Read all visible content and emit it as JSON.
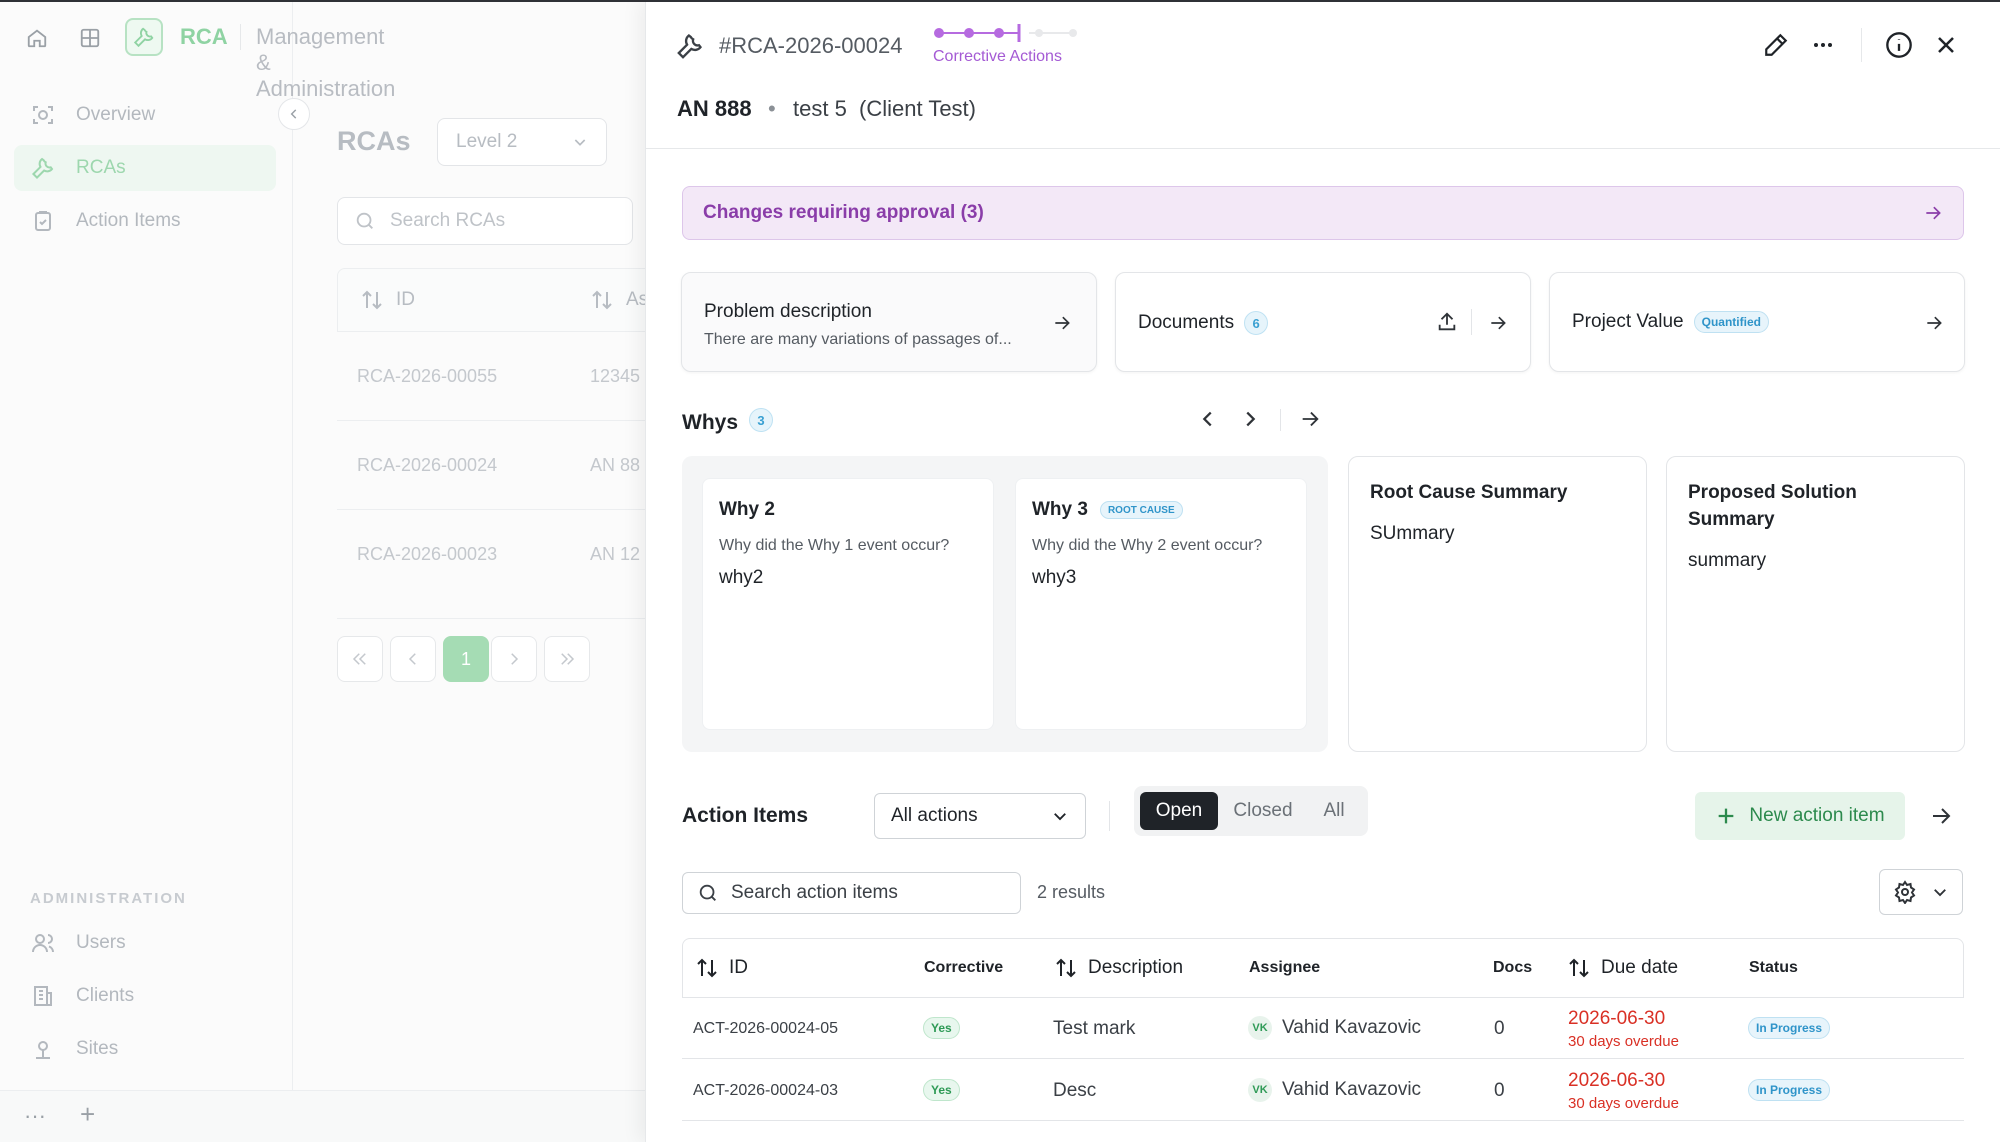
{
  "topbar": {
    "brand": "RCA",
    "section": "Management & Administration"
  },
  "sidebar": {
    "items": [
      {
        "label": "Overview",
        "icon": "overview-icon"
      },
      {
        "label": "RCAs",
        "icon": "wrench-icon"
      },
      {
        "label": "Action Items",
        "icon": "clipboard-icon"
      }
    ],
    "admin_label": "ADMINISTRATION",
    "admin_items": [
      {
        "label": "Users",
        "icon": "users-icon"
      },
      {
        "label": "Clients",
        "icon": "building-icon"
      },
      {
        "label": "Sites",
        "icon": "location-icon"
      }
    ]
  },
  "list": {
    "title": "RCAs",
    "level": "Level 2",
    "search_placeholder": "Search RCAs",
    "col_id": "ID",
    "col_as": "As",
    "rows": [
      {
        "id": "RCA-2026-00055",
        "as": "12345"
      },
      {
        "id": "RCA-2026-00024",
        "as": "AN 88"
      },
      {
        "id": "RCA-2026-00023",
        "as": "AN 12"
      }
    ],
    "page": "1"
  },
  "drawer": {
    "rca_id": "#RCA-2026-00024",
    "step_label": "Corrective Actions",
    "aircraft": "AN 888",
    "dot": "•",
    "subtitle": "test 5  (Client Test)",
    "approval": "Changes requiring approval (3)",
    "cards": {
      "problem_title": "Problem description",
      "problem_sub": "There are many variations of passages of...",
      "documents_title": "Documents",
      "documents_count": "6",
      "project_title": "Project Value",
      "project_badge": "Quantified"
    },
    "whys": {
      "title": "Whys",
      "count": "3",
      "items": [
        {
          "title": "Why 2",
          "question": "Why did the Why 1 event occur?",
          "answer": "why2",
          "badge": ""
        },
        {
          "title": "Why 3",
          "question": "Why did the Why 2 event occur?",
          "answer": "why3",
          "badge": "ROOT CAUSE"
        }
      ]
    },
    "root_cause": {
      "title": "Root Cause Summary",
      "body": "SUmmary"
    },
    "proposed": {
      "title": "Proposed Solution Summary",
      "body": "summary"
    },
    "action_items": {
      "title": "Action Items",
      "filter": "All actions",
      "segments": [
        "Open",
        "Closed",
        "All"
      ],
      "new_label": "New action item",
      "search_placeholder": "Search action items",
      "results": "2 results",
      "columns": {
        "id": "ID",
        "corrective": "Corrective",
        "description": "Description",
        "assignee": "Assignee",
        "docs": "Docs",
        "due": "Due date",
        "status": "Status"
      },
      "rows": [
        {
          "id": "ACT-2026-00024-05",
          "corrective": "Yes",
          "description": "Test mark",
          "initials": "VK",
          "assignee": "Vahid Kavazovic",
          "docs": "0",
          "due": "2026-06-30",
          "overdue": "30 days overdue",
          "status": "In Progress"
        },
        {
          "id": "ACT-2026-00024-03",
          "corrective": "Yes",
          "description": "Desc",
          "initials": "VK",
          "assignee": "Vahid Kavazovic",
          "docs": "0",
          "due": "2026-06-30",
          "overdue": "30 days overdue",
          "status": "In Progress"
        }
      ]
    }
  },
  "colors": {
    "accent_green": "#2e9a56",
    "accent_purple": "#a45ad4",
    "overdue_red": "#d93025",
    "status_blue": "#2f94c9"
  }
}
